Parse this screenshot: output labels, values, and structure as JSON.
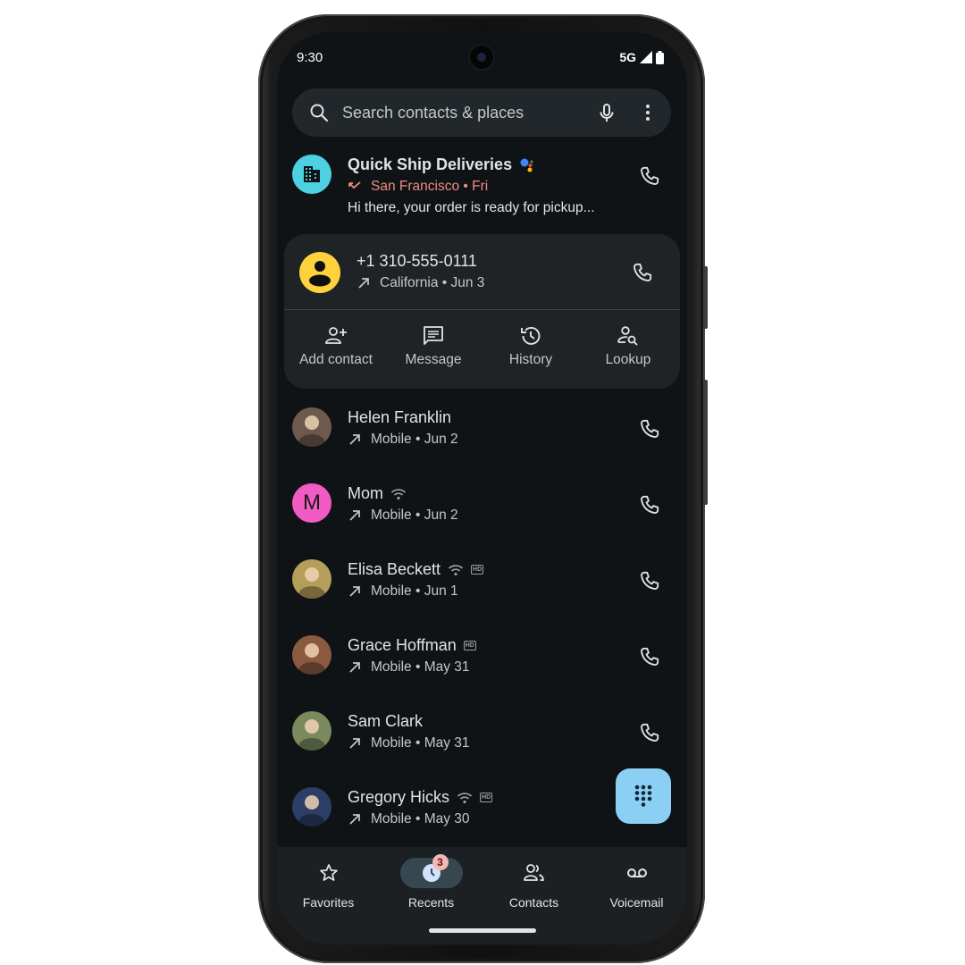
{
  "status_bar": {
    "time": "9:30",
    "network": "5G"
  },
  "search": {
    "placeholder": "Search contacts & places"
  },
  "featured_call": {
    "name": "Quick Ship Deliveries",
    "detail": "San Francisco • Fri",
    "message": "Hi there, your order is ready for pickup...",
    "avatar_color": "#4dd0e1",
    "detail_color": "#f28b82",
    "call_type": "missed"
  },
  "expanded_call": {
    "number": "+1 310-555-0111",
    "detail": "California • Jun 3",
    "avatar_color": "#fdd23c",
    "actions": [
      {
        "label": "Add contact",
        "icon": "add-contact-icon"
      },
      {
        "label": "Message",
        "icon": "message-icon"
      },
      {
        "label": "History",
        "icon": "history-icon"
      },
      {
        "label": "Lookup",
        "icon": "lookup-icon"
      }
    ]
  },
  "calls": [
    {
      "name": "Helen Franklin",
      "detail": "Mobile • Jun 2",
      "wifi": false,
      "hd": false,
      "avatar": "photo",
      "avatar_color": "#6d5a4c"
    },
    {
      "name": "Mom",
      "detail": "Mobile • Jun 2",
      "wifi": true,
      "hd": false,
      "avatar": "letter",
      "letter": "M",
      "avatar_color": "#f25ac4"
    },
    {
      "name": "Elisa Beckett",
      "detail": "Mobile • Jun 1",
      "wifi": true,
      "hd": true,
      "avatar": "photo",
      "avatar_color": "#b59d5a"
    },
    {
      "name": "Grace Hoffman",
      "detail": "Mobile • May 31",
      "wifi": false,
      "hd": true,
      "avatar": "photo",
      "avatar_color": "#8a5a3f"
    },
    {
      "name": "Sam Clark",
      "detail": "Mobile • May 31",
      "wifi": false,
      "hd": false,
      "avatar": "photo",
      "avatar_color": "#7a8a5e"
    },
    {
      "name": "Gregory Hicks",
      "detail": "Mobile • May 30",
      "wifi": true,
      "hd": true,
      "avatar": "photo",
      "avatar_color": "#2c3e66"
    }
  ],
  "hd_label": "HD",
  "fab": {
    "icon": "dialpad-icon",
    "color": "#8ccff4"
  },
  "nav": {
    "items": [
      {
        "label": "Favorites",
        "icon": "star-icon",
        "active": false
      },
      {
        "label": "Recents",
        "icon": "clock-icon",
        "active": true,
        "badge": "3"
      },
      {
        "label": "Contacts",
        "icon": "contacts-icon",
        "active": false
      },
      {
        "label": "Voicemail",
        "icon": "voicemail-icon",
        "active": false
      }
    ]
  }
}
